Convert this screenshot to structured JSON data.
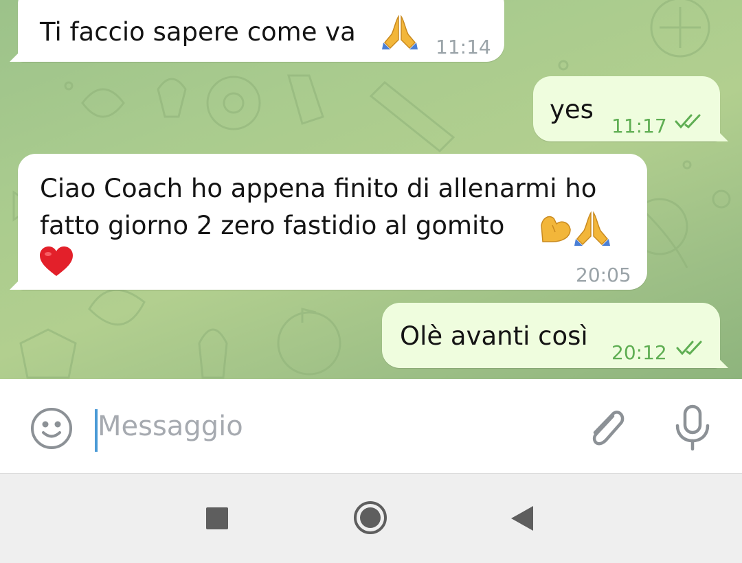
{
  "messages": [
    {
      "text": "Ti faccio sapere come va",
      "emoji_after": "folded-hands",
      "time": "11:14",
      "direction": "incoming"
    },
    {
      "text": "yes",
      "time": "11:17",
      "direction": "outgoing",
      "read": true
    },
    {
      "lines": [
        "Ciao Coach ho appena finito di allenarmi ho",
        "fatto giorno 2 zero fastidio al gomito"
      ],
      "emoji_after": [
        "flexed-biceps",
        "folded-hands",
        "red-heart"
      ],
      "time": "20:05",
      "direction": "incoming"
    },
    {
      "text": "Olè avanti così",
      "time": "20:12",
      "direction": "outgoing",
      "read": true
    }
  ],
  "composer": {
    "placeholder": "Messaggio",
    "icons": [
      "smiley-icon",
      "paperclip-icon",
      "microphone-icon"
    ]
  },
  "navbar": {
    "icons": [
      "recent-apps-icon",
      "home-icon",
      "back-icon"
    ]
  },
  "colors": {
    "incoming_bubble": "#ffffff",
    "outgoing_bubble": "#effdde",
    "outgoing_time": "#5fae53",
    "cursor": "#4a9ad6"
  }
}
